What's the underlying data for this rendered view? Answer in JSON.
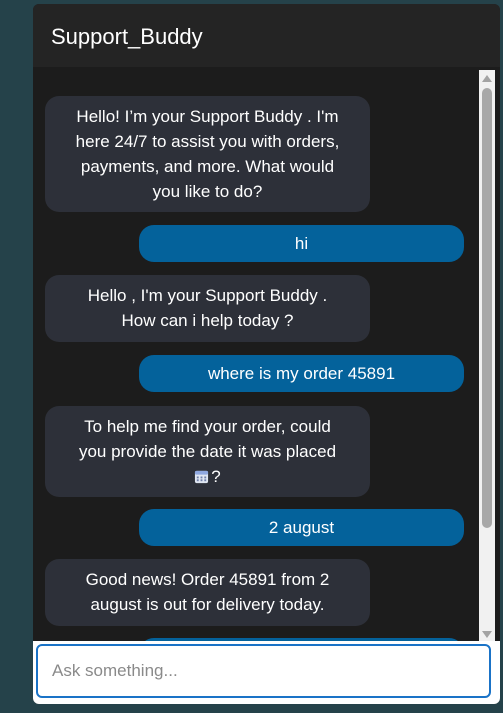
{
  "header": {
    "title": "Support_Buddy"
  },
  "messages": [
    {
      "sender": "bot",
      "text": "Hello! I’m your Support Buddy . I'm\nhere 24/7 to assist you with orders,\npayments, and more. What would\nyou like to do?"
    },
    {
      "sender": "user",
      "text": "hi"
    },
    {
      "sender": "bot",
      "text": "Hello , I'm your Support Buddy .\nHow can i help today ?"
    },
    {
      "sender": "user",
      "text": "where is my order 45891"
    },
    {
      "sender": "bot",
      "text_line1": "To help me find your order, could",
      "text_line2": "you provide the date it was placed",
      "text_end": "?",
      "icon": "calendar-icon"
    },
    {
      "sender": "user",
      "text": "2 august"
    },
    {
      "sender": "bot",
      "text": "Good news! Order 45891 from 2\naugust is out for delivery today."
    },
    {
      "sender": "user",
      "text": ""
    }
  ],
  "input": {
    "placeholder": "Ask something..."
  },
  "colors": {
    "page_bg": "#25424a",
    "window_bg": "#1c1c1c",
    "header_bg": "#242424",
    "bot_bubble": "#2d3039",
    "user_bubble": "#04629b",
    "input_border": "#1a73c7"
  }
}
